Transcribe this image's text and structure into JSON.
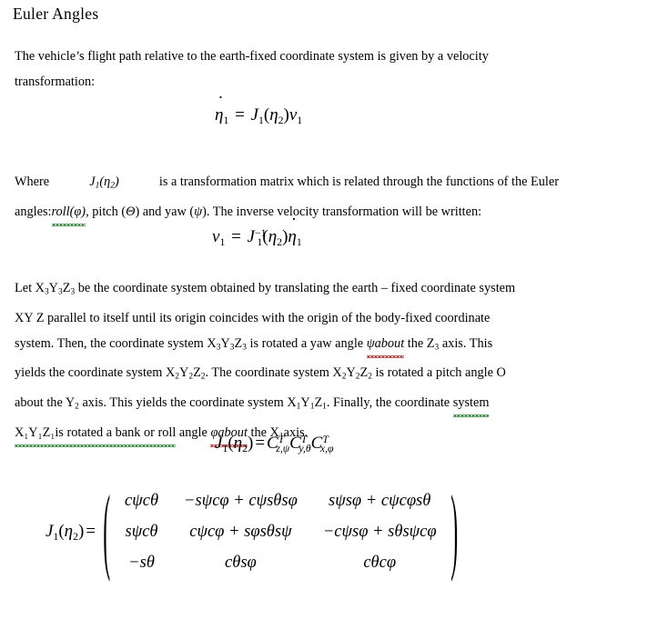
{
  "document": {
    "heading": "Euler Angles",
    "background_color": "#ffffff",
    "text_color": "#000000",
    "spellcheck_red_color": "#d02020",
    "grammarcheck_green_color": "#1d8a2a"
  },
  "paragraph1": {
    "line1": "The vehicle’s flight path relative to the earth-fixed coordinate system is given by a velocity",
    "line2": "transformation:"
  },
  "equation1": {
    "lhs_symbol": "η",
    "lhs_sub": "1",
    "lhs_has_dot": true,
    "equals": "=",
    "rhs_J": "J",
    "rhs_J_sub": "1",
    "rhs_open": "(",
    "rhs_eta": "η",
    "rhs_eta_sub": "2",
    "rhs_close": ")",
    "rhs_nu": "ν",
    "rhs_nu_sub": "1",
    "plain": "η̇1 = J1(η2)ν1"
  },
  "paragraph2": {
    "line1_pre": "Where",
    "line1_math_J": "J",
    "line1_math_J_sub": "1",
    "line1_math_open": "(",
    "line1_math_eta": "η",
    "line1_math_eta_sub": "2",
    "line1_math_close": ")",
    "line1_post": "is a transformation matrix which is related through the functions of the Euler",
    "line2_a": "angles: ",
    "line2_misspelled": "roll(φ)",
    "line2_b": ", pitch (",
    "line2_theta": "Θ",
    "line2_c": ") and yaw (",
    "line2_psi": "ψ",
    "line2_d": "). The inverse velocity transformation will be written:"
  },
  "equation2": {
    "lhs_nu": "ν",
    "lhs_nu_sub": "1",
    "equals": "=",
    "rhs_J": "J",
    "rhs_J_sub": "1",
    "rhs_J_sup": "−1",
    "rhs_open": "(",
    "rhs_eta": "η",
    "rhs_eta_sub": "2",
    "rhs_close": ")",
    "rhs_etadot": "η",
    "rhs_etadot_sub": "1",
    "plain": "ν1 = J1⁻¹(η2)η̇1"
  },
  "paragraph3": {
    "line1_a": "Let X",
    "line1_sub1": "3",
    "line1_b": "Y",
    "line1_sub2": "3",
    "line1_c": "Z",
    "line1_sub3": "3",
    "line1_d": " be the coordinate system obtained by translating the earth – fixed coordinate system",
    "line2": "XY Z parallel to itself until its origin coincides with the origin of the body-fixed coordinate",
    "line3_a": "system. Then, the coordinate system X",
    "line3_sub1": "3",
    "line3_b": "Y",
    "line3_sub2": "3",
    "line3_c": "Z",
    "line3_sub3": "3",
    "line3_d": " is rotated a yaw angle ",
    "line3_misspelled": "ψabout",
    "line3_e": " the Z",
    "line3_sub4": "3",
    "line3_f": " axis. This",
    "line4_a": "yields the coordinate system X",
    "line4_sub1": "2",
    "line4_b": "Y",
    "line4_sub2": "2",
    "line4_c": "Z",
    "line4_sub3": "2",
    "line4_d": ". The coordinate system X",
    "line4_sub4": "2",
    "line4_e": "Y",
    "line4_sub5": "2",
    "line4_f": "Z",
    "line4_sub6": "2",
    "line4_g": " is rotated a pitch angle O",
    "line5_a": "about the Y",
    "line5_sub1": "2",
    "line5_b": " axis. This yields the coordinate system X",
    "line5_sub2": "1",
    "line5_c": "Y",
    "line5_sub3": "1",
    "line5_d": "Z",
    "line5_sub4": "1",
    "line5_e": ". Finally, the coordinate ",
    "line5_grammar": "system",
    "line6_grammar": "X₁Y₁Z₁is rotated a bank or roll",
    "line6_a": " angle ",
    "line6_misspelled": "φabout",
    "line6_b": " the X",
    "line6_sub1": "1",
    "line6_c": "axis."
  },
  "equation3": {
    "lhs_J": "J",
    "lhs_J_sub": "1",
    "lhs_open": "(",
    "lhs_eta": "η",
    "lhs_eta_sub": "2",
    "lhs_close": ")",
    "equals": "=",
    "c1": "C",
    "c1_sup": "T",
    "c1_sub": "z,ψ",
    "c2": "C",
    "c2_sup": "T",
    "c2_sub": "y,θ",
    "c3": "C",
    "c3_sup": "T",
    "c3_sub": "x,φ",
    "plain": "J1(η2) = Cᵀz,ψ Cᵀy,θ Cᵀx,φ"
  },
  "matrix_equation": {
    "lhs_J": "J",
    "lhs_J_sub": "1",
    "lhs_open": "(",
    "lhs_eta": "η",
    "lhs_eta_sub": "2",
    "lhs_close": ")",
    "equals": "=",
    "left_bracket": "(",
    "right_bracket": ")",
    "rows": [
      [
        "cψcθ",
        "−sψcφ + cψsθsφ",
        "sψsφ + cψcφsθ"
      ],
      [
        "sψcθ",
        "cψcφ + sφsθsψ",
        "−cψsφ + sθsψcφ"
      ],
      [
        "−sθ",
        "cθsφ",
        "cθcφ"
      ]
    ]
  }
}
